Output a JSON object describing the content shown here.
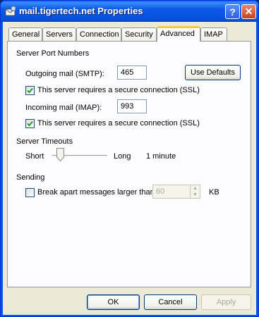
{
  "window": {
    "title": "mail.tigertech.net Properties"
  },
  "titlebar": {
    "help_glyph": "?",
    "close_glyph": "✕"
  },
  "tabs": [
    {
      "label": "General"
    },
    {
      "label": "Servers"
    },
    {
      "label": "Connection"
    },
    {
      "label": "Security"
    },
    {
      "label": "Advanced",
      "active": true
    },
    {
      "label": "IMAP"
    }
  ],
  "server_ports": {
    "heading": "Server Port Numbers",
    "outgoing_label": "Outgoing mail (SMTP):",
    "outgoing_value": "465",
    "use_defaults_label": "Use Defaults",
    "outgoing_ssl_label": "This server requires a secure connection (SSL)",
    "outgoing_ssl_checked": true,
    "incoming_label": "Incoming mail (IMAP):",
    "incoming_value": "993",
    "incoming_ssl_label": "This server requires a secure connection (SSL)",
    "incoming_ssl_checked": true
  },
  "timeouts": {
    "heading": "Server Timeouts",
    "short_label": "Short",
    "long_label": "Long",
    "value_label": "1 minute",
    "slider_level": 0.12
  },
  "sending": {
    "heading": "Sending",
    "break_apart_label": "Break apart messages larger than",
    "break_apart_checked": false,
    "size_value": "60",
    "unit_label": "KB"
  },
  "buttons": {
    "ok": "OK",
    "cancel": "Cancel",
    "apply": "Apply"
  },
  "icons": {
    "app": "mail-server-icon",
    "help": "help-icon",
    "close": "close-icon",
    "check": "checkmark-icon",
    "spin_up": "spin-up-icon",
    "spin_down": "spin-down-icon",
    "slider_thumb": "slider-thumb-icon"
  },
  "colors": {
    "titlebar": "#0054e3",
    "dialog_bg": "#ece9d8",
    "tab_active_accent": "#ffc83c",
    "check_green": "#21a121"
  }
}
